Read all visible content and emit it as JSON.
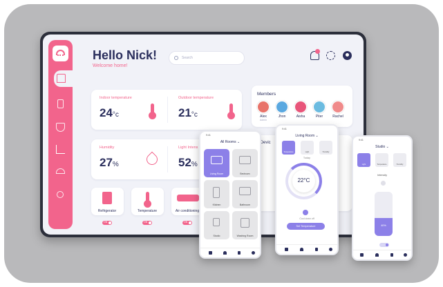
{
  "header": {
    "greeting": "Hello Nick!",
    "subtitle": "Welcome home!",
    "search_placeholder": "Search",
    "notification_count": "1"
  },
  "stats": {
    "indoor": {
      "label": "Indoor temperature",
      "value": "24",
      "unit": "°c"
    },
    "outdoor": {
      "label": "Outdoor temperature",
      "value": "21",
      "unit": "°c"
    },
    "humidity": {
      "label": "Humidity",
      "value": "27",
      "unit": "%"
    },
    "light": {
      "label": "Light Intens",
      "value": "52",
      "unit": "%"
    }
  },
  "members": {
    "title": "Members",
    "list": [
      {
        "name": "Alex",
        "role": "Admin",
        "color": "#e8736a"
      },
      {
        "name": "Jhon",
        "role": "",
        "color": "#5aa8e0"
      },
      {
        "name": "Aisha",
        "role": "",
        "color": "#e8557a"
      },
      {
        "name": "Piter",
        "role": "",
        "color": "#6bbbe0"
      },
      {
        "name": "Rachel",
        "role": "",
        "color": "#f08a8a"
      }
    ]
  },
  "devices_title": "y Devic",
  "devices": [
    {
      "label": "Refrigerator",
      "toggle": "ON"
    },
    {
      "label": "Temperature",
      "toggle": "ON"
    },
    {
      "label": "Air conditioning",
      "toggle": "ON"
    }
  ],
  "phone1": {
    "title": "All Rooms ⌄",
    "rooms": [
      "Living Room",
      "Bedroom",
      "Kitchen",
      "Bathroom",
      "Studio",
      "Washing Room"
    ]
  },
  "phone2": {
    "title": "Living Room ⌄",
    "modes": [
      "Temperature",
      "Light",
      "Humidity"
    ],
    "period": "Today",
    "temperature": "22°C",
    "status": "Cool down off",
    "button": "Set Temperature"
  },
  "phone3": {
    "title": "Studio ⌄",
    "modes": [
      "Light",
      "Temperature",
      "Humidity"
    ],
    "slider_label": "Intensity",
    "level": "40%"
  },
  "colors": {
    "accent": "#f2648c",
    "navy": "#2a2e5c",
    "purple": "#8c80e8"
  }
}
